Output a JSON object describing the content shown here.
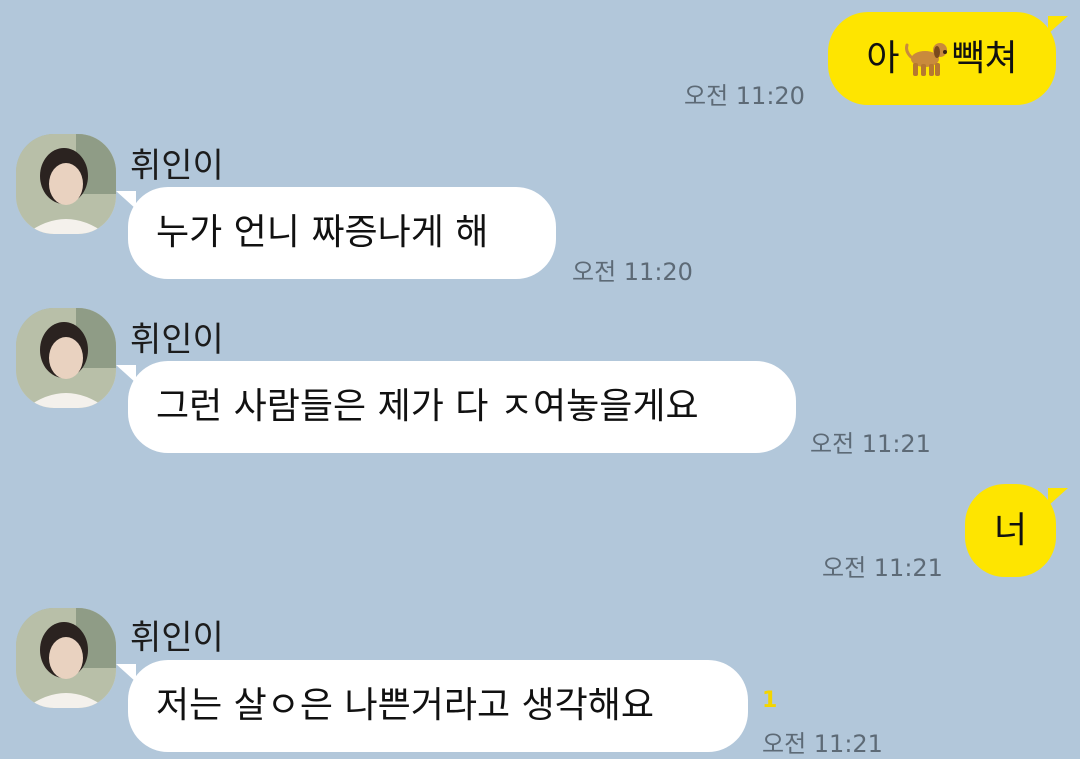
{
  "messages": {
    "m1": {
      "text_before": "아",
      "icon": "dog-emoji",
      "text_after": "빽쳐",
      "time": "오전 11:20"
    },
    "m2": {
      "sender": "휘인이",
      "text": "누가 언니 짜증나게 해",
      "time": "오전 11:20"
    },
    "m3": {
      "sender": "휘인이",
      "text": "그런 사람들은 제가 다 ㅈ여놓을게요",
      "time": "오전 11:21"
    },
    "m4": {
      "text": "너",
      "time": "오전 11:21"
    },
    "m5": {
      "sender": "휘인이",
      "text": "저는 살ㅇ은 나쁜거라고 생각해요",
      "time": "오전 11:21",
      "unread": "1"
    }
  },
  "colors": {
    "background": "#b2c7da",
    "sent_bubble": "#fee500",
    "received_bubble": "#ffffff",
    "timestamp": "#5d6a76",
    "unread_count": "#f3d500"
  }
}
